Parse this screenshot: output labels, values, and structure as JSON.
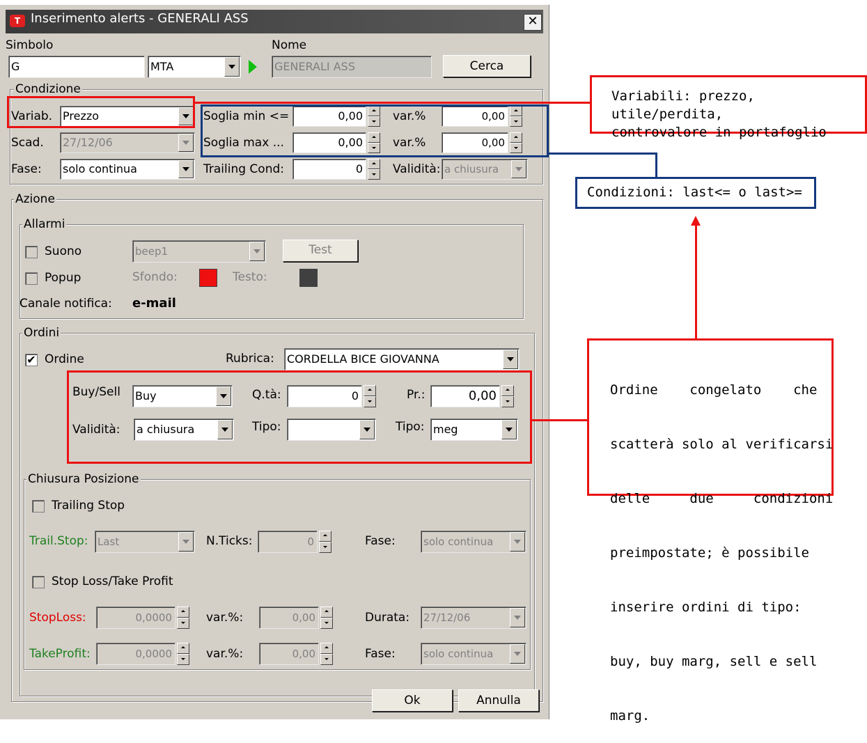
{
  "window": {
    "title": "Inserimento alerts - GENERALI ASS",
    "close": "✕"
  },
  "header": {
    "simbolo_label": "Simbolo",
    "simbolo_value": "G",
    "market_value": "MTA",
    "nome_label": "Nome",
    "nome_value": "GENERALI ASS",
    "cerca_label": "Cerca"
  },
  "condizione": {
    "group_label": "Condizione",
    "variab_label": "Variab.",
    "variab_value": "Prezzo",
    "scad_label": "Scad.",
    "scad_value": "27/12/06",
    "fase_label": "Fase:",
    "fase_value": "solo continua",
    "soglia_min_label": "Soglia min <=",
    "soglia_min_value": "0,00",
    "soglia_max_label": "Soglia max ...",
    "soglia_max_value": "0,00",
    "trailing_label": "Trailing Cond:",
    "trailing_value": "0",
    "varp_label": "var.%",
    "varp_min_value": "0,00",
    "varp_max_value": "0,00",
    "validita_label": "Validità:",
    "validita_value": "a chiusura"
  },
  "azione": {
    "group_label": "Azione",
    "allarmi": {
      "group_label": "Allarmi",
      "suono_label": "Suono",
      "suono_value": "beep1",
      "test_label": "Test",
      "popup_label": "Popup",
      "sfondo_label": "Sfondo:",
      "testo_label": "Testo:",
      "canale_label": "Canale notifica:",
      "canale_value": "e-mail",
      "sfondo_color": "#ee1010",
      "testo_color": "#404040"
    },
    "ordini": {
      "group_label": "Ordini",
      "ordine_label": "Ordine",
      "ordine_checked": "✔",
      "rubrica_label": "Rubrica:",
      "rubrica_value": "CORDELLA BICE GIOVANNA",
      "buysell_label": "Buy/Sell",
      "buysell_value": "Buy",
      "qta_label": "Q.tà:",
      "qta_value": "0",
      "pr_label": "Pr.:",
      "pr_value": "0,00",
      "validita_label": "Validità:",
      "validita_value": "a chiusura",
      "tipo_label": "Tipo:",
      "tipo_value": "",
      "tipo2_label": "Tipo:",
      "tipo2_value": "meg"
    },
    "chiusura": {
      "group_label": "Chiusura Posizione",
      "trailing_stop_label": "Trailing Stop",
      "trailstop_label": "Trail.Stop:",
      "trailstop_value": "Last",
      "nticks_label": "N.Ticks:",
      "nticks_value": "0",
      "fase_label": "Fase:",
      "fase_value": "solo continua",
      "sltp_label": "Stop Loss/Take Profit",
      "stoploss_label": "StopLoss:",
      "stoploss_value": "0,0000",
      "varp_label": "var.%:",
      "stoploss_varp": "0,00",
      "durata_label": "Durata:",
      "durata_value": "27/12/06",
      "takeprofit_label": "TakeProfit:",
      "takeprofit_value": "0,0000",
      "takeprofit_varp": "0,00",
      "fase2_label": "Fase:",
      "fase2_value": "solo continua"
    }
  },
  "footer": {
    "ok_label": "Ok",
    "annulla_label": "Annulla"
  },
  "annotations": {
    "variabili_line1": "Variabili: prezzo, utile/perdita,",
    "variabili_line2": "controvalore in portafoglio",
    "condizioni": "Condizioni: last<= o last>=",
    "ordine_lines": [
      "Ordine    congelato    che",
      "scatterà solo al verificarsi",
      "delle     due     condizioni",
      "preimpostate; è possibile",
      "inserire ordini di tipo:",
      "buy, buy marg, sell e sell",
      "marg."
    ]
  },
  "colors": {
    "annotation_red": "#ea1212",
    "annotation_blue": "#143a7e",
    "dialog_bg": "#d4d0c8"
  }
}
